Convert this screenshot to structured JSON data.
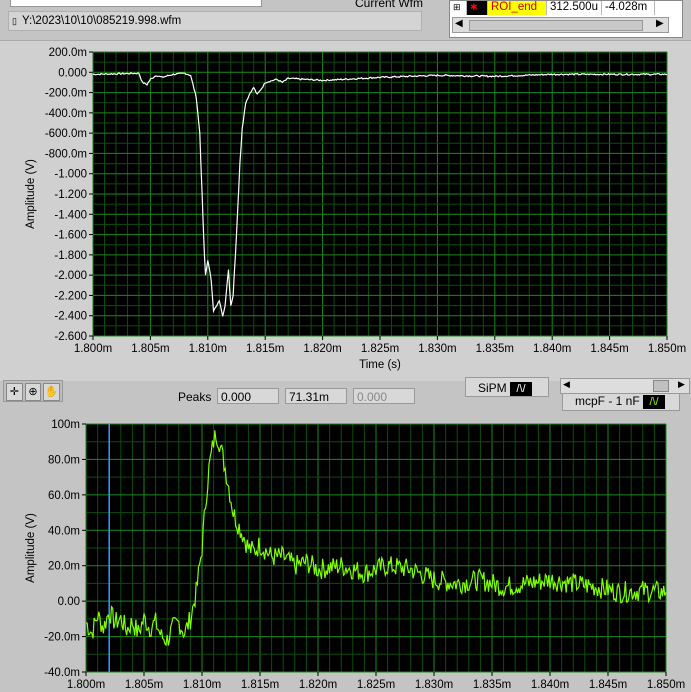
{
  "header": {
    "current_wfm_label": "Current Wfm",
    "file_path": "Y:\\2023\\10\\10\\085219.998.wfm",
    "path_icon": "file-path-icon"
  },
  "cursor_table": {
    "rows": [
      {
        "name": "ROI_end",
        "x": "312.500u",
        "y": "-4.028m"
      }
    ]
  },
  "controls": {
    "tools": [
      "cursor-tool-icon",
      "zoom-tool-icon",
      "pan-hand-icon"
    ],
    "peaks_label": "Peaks",
    "peaks_values": [
      "0.000",
      "71.31m",
      "0.000"
    ],
    "legend_sipm": "SiPM",
    "legend_mcpf": "mcpF - 1 nF"
  },
  "colors": {
    "plot_bg": "#000000",
    "grid_major": "#1a8a1a",
    "grid_minor": "#0d4d0d",
    "top_trace": "#ffffff",
    "bottom_trace": "#80ff00",
    "cursor": "#3399ff"
  },
  "chart_data": [
    {
      "type": "line",
      "xlabel": "Time (s)",
      "ylabel": "Amplitude (V)",
      "xlim": [
        0.0018,
        0.00185
      ],
      "ylim": [
        -2.6,
        0.2
      ],
      "grid": true,
      "xticks": [
        "1.800m",
        "1.805m",
        "1.810m",
        "1.815m",
        "1.820m",
        "1.825m",
        "1.830m",
        "1.835m",
        "1.840m",
        "1.845m",
        "1.850m"
      ],
      "yticks": [
        "200.0m",
        "0.000",
        "-200.0m",
        "-400.0m",
        "-600.0m",
        "-800.0m",
        "-1.000",
        "-1.200",
        "-1.400",
        "-1.600",
        "-1.800",
        "-2.000",
        "-2.200",
        "-2.400",
        "-2.600"
      ],
      "x": [
        1.8,
        1.804,
        1.8043,
        1.8047,
        1.805,
        1.8055,
        1.806,
        1.807,
        1.808,
        1.8085,
        1.809,
        1.8093,
        1.8095,
        1.8097,
        1.8098,
        1.81,
        1.8103,
        1.8105,
        1.8108,
        1.811,
        1.8113,
        1.8115,
        1.8118,
        1.812,
        1.8122,
        1.8125,
        1.8128,
        1.813,
        1.8133,
        1.8137,
        1.814,
        1.8143,
        1.8148,
        1.815,
        1.816,
        1.8165,
        1.817,
        1.82,
        1.825,
        1.83,
        1.835,
        1.84,
        1.845,
        1.85
      ],
      "x_unit": "ms",
      "y": [
        -0.02,
        -0.01,
        -0.1,
        -0.12,
        -0.07,
        -0.03,
        -0.05,
        -0.02,
        -0.01,
        -0.03,
        -0.25,
        -0.6,
        -1.2,
        -1.8,
        -2.0,
        -1.85,
        -2.05,
        -2.35,
        -2.3,
        -2.25,
        -2.4,
        -2.3,
        -1.95,
        -2.3,
        -2.2,
        -1.6,
        -0.9,
        -0.55,
        -0.3,
        -0.2,
        -0.15,
        -0.22,
        -0.14,
        -0.1,
        -0.07,
        -0.1,
        -0.06,
        -0.08,
        -0.05,
        -0.03,
        -0.04,
        -0.02,
        -0.02,
        -0.02
      ]
    },
    {
      "type": "line",
      "xlabel": "",
      "ylabel": "Amplitude (V)",
      "xlim": [
        0.0018,
        0.00185
      ],
      "ylim": [
        -0.04,
        0.1
      ],
      "grid": true,
      "cursor_x": 1.802,
      "xticks": [
        "1.800m",
        "1.805m",
        "1.810m",
        "1.815m",
        "1.820m",
        "1.825m",
        "1.830m",
        "1.835m",
        "1.840m",
        "1.845m",
        "1.850m"
      ],
      "yticks": [
        "100m",
        "80.0m",
        "60.0m",
        "40.0m",
        "20.0m",
        "0.00",
        "-20.0m",
        "-40.0m"
      ],
      "x": [
        1.8,
        1.8005,
        1.801,
        1.8015,
        1.802,
        1.8025,
        1.803,
        1.8035,
        1.804,
        1.8045,
        1.805,
        1.8055,
        1.806,
        1.8065,
        1.807,
        1.8075,
        1.808,
        1.8085,
        1.809,
        1.8095,
        1.81,
        1.8103,
        1.8106,
        1.811,
        1.8112,
        1.8115,
        1.812,
        1.8123,
        1.8127,
        1.813,
        1.8135,
        1.814,
        1.8145,
        1.815,
        1.816,
        1.817,
        1.818,
        1.819,
        1.82,
        1.822,
        1.824,
        1.826,
        1.828,
        1.83,
        1.832,
        1.834,
        1.836,
        1.838,
        1.84,
        1.842,
        1.844,
        1.846,
        1.848,
        1.85
      ],
      "x_unit": "ms",
      "y": [
        -0.012,
        -0.018,
        -0.008,
        -0.015,
        -0.006,
        -0.012,
        -0.01,
        -0.016,
        -0.012,
        -0.018,
        -0.01,
        -0.015,
        -0.012,
        -0.02,
        -0.022,
        -0.015,
        -0.012,
        -0.018,
        -0.01,
        0.005,
        0.03,
        0.055,
        0.075,
        0.09,
        0.095,
        0.09,
        0.075,
        0.065,
        0.05,
        0.045,
        0.038,
        0.03,
        0.028,
        0.032,
        0.025,
        0.025,
        0.02,
        0.022,
        0.018,
        0.02,
        0.016,
        0.02,
        0.018,
        0.012,
        0.01,
        0.012,
        0.008,
        0.01,
        0.012,
        0.01,
        0.008,
        0.005,
        0.006,
        0.005
      ]
    }
  ]
}
